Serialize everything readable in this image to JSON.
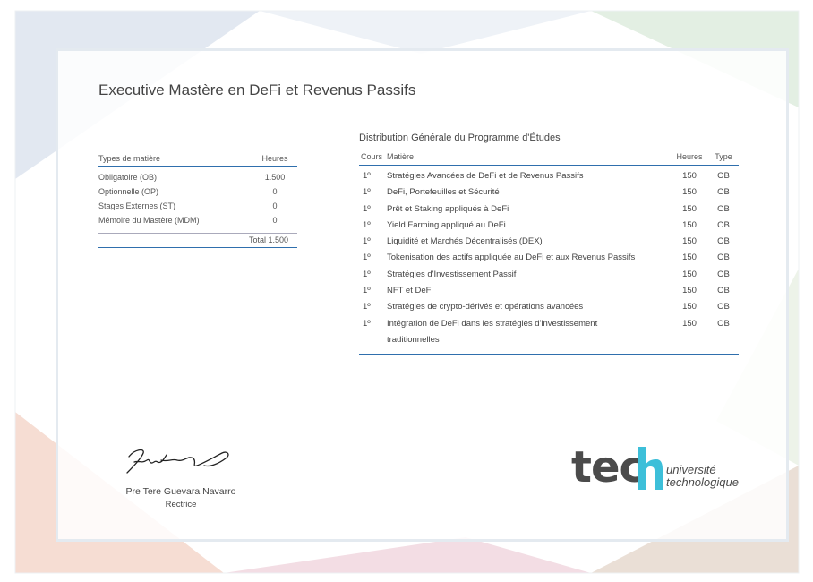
{
  "document": {
    "title": "Executive Mastère en DeFi et Revenus Passifs"
  },
  "summary_table": {
    "col_type": "Types de matière",
    "col_hours": "Heures",
    "rows": [
      {
        "label": "Obligatoire (OB)",
        "hours": "1.500"
      },
      {
        "label": "Optionnelle (OP)",
        "hours": "0"
      },
      {
        "label": "Stages Externes (ST)",
        "hours": "0"
      },
      {
        "label": "Mémoire du Mastère (MDM)",
        "hours": "0"
      }
    ],
    "total": "Total 1.500"
  },
  "program_table": {
    "title": "Distribution Générale du Programme d'Études",
    "col_course": "Cours",
    "col_subject": "Matière",
    "col_hours": "Heures",
    "col_type": "Type",
    "rows": [
      {
        "course": "1º",
        "subject": "Stratégies Avancées de DeFi et de Revenus Passifs",
        "hours": "150",
        "type": "OB"
      },
      {
        "course": "1º",
        "subject": "DeFi, Portefeuilles et Sécurité",
        "hours": "150",
        "type": "OB"
      },
      {
        "course": "1º",
        "subject": "Prêt et Staking appliqués à DeFi",
        "hours": "150",
        "type": "OB"
      },
      {
        "course": "1º",
        "subject": "Yield Farming appliqué au DeFi",
        "hours": "150",
        "type": "OB"
      },
      {
        "course": "1º",
        "subject": "Liquidité et Marchés Décentralisés (DEX)",
        "hours": "150",
        "type": "OB"
      },
      {
        "course": "1º",
        "subject": "Tokenisation des actifs appliquée au DeFi et aux Revenus Passifs",
        "hours": "150",
        "type": "OB"
      },
      {
        "course": "1º",
        "subject": "Stratégies d'Investissement Passif",
        "hours": "150",
        "type": "OB"
      },
      {
        "course": "1º",
        "subject": "NFT et DeFi",
        "hours": "150",
        "type": "OB"
      },
      {
        "course": "1º",
        "subject": "Stratégies de crypto-dérivés et opérations avancées",
        "hours": "150",
        "type": "OB"
      },
      {
        "course": "1º",
        "subject": "Intégration de DeFi dans les stratégies d'investissement traditionnelles",
        "hours": "150",
        "type": "OB"
      }
    ]
  },
  "signatory": {
    "name": "Pre Tere Guevara Navarro",
    "role": "Rectrice"
  },
  "logo": {
    "word": "tec",
    "line1": "université",
    "line2": "technologique",
    "accent": "#3dbfd9"
  }
}
